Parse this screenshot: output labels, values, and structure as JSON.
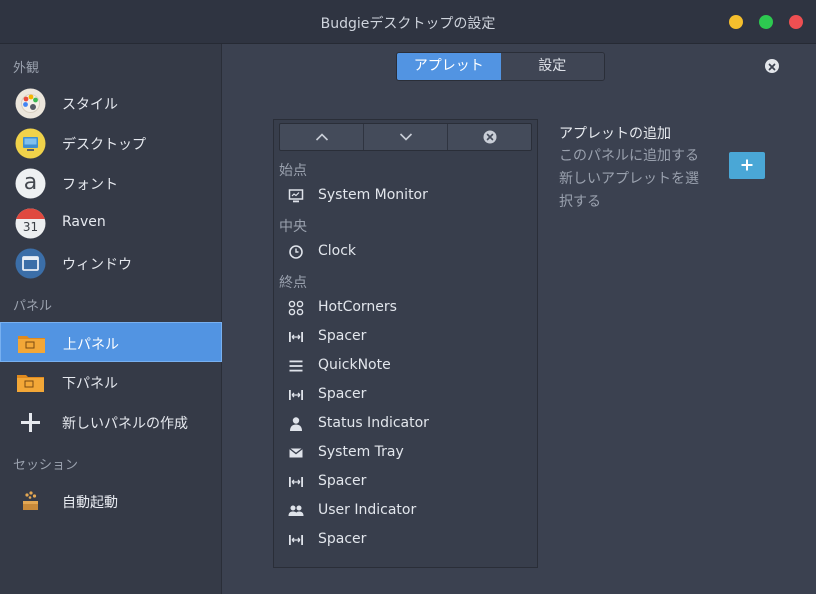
{
  "window": {
    "title": "Budgieデスクトップの設定"
  },
  "sidebar": {
    "sections": [
      {
        "heading": "外観"
      },
      {
        "heading": "パネル"
      },
      {
        "heading": "セッション"
      }
    ],
    "items": [
      {
        "label": "スタイル",
        "icon": "style-palette-icon"
      },
      {
        "label": "デスクトップ",
        "icon": "desktop-icon"
      },
      {
        "label": "フォント",
        "icon": "font-icon"
      },
      {
        "label": "Raven",
        "icon": "calendar-icon"
      },
      {
        "label": "ウィンドウ",
        "icon": "window-icon"
      },
      {
        "label": "上パネル",
        "icon": "folder-icon",
        "selected": true
      },
      {
        "label": "下パネル",
        "icon": "folder-icon"
      },
      {
        "label": "新しいパネルの作成",
        "icon": "plus-icon"
      },
      {
        "label": "自動起動",
        "icon": "autostart-icon"
      }
    ],
    "calendar_day": "31",
    "font_glyph": "a"
  },
  "tabs": [
    {
      "label": "アプレット",
      "active": true
    },
    {
      "label": "設定",
      "active": false
    }
  ],
  "applets": {
    "groups": [
      {
        "label": "始点"
      },
      {
        "label": "中央"
      },
      {
        "label": "終点"
      }
    ],
    "items": [
      {
        "label": "System Monitor",
        "icon": "monitor-icon"
      },
      {
        "label": "Clock",
        "icon": "clock-icon"
      },
      {
        "label": "HotCorners",
        "icon": "hotcorners-icon"
      },
      {
        "label": "Spacer",
        "icon": "spacer-icon"
      },
      {
        "label": "QuickNote",
        "icon": "menu-lines-icon"
      },
      {
        "label": "Spacer",
        "icon": "spacer-icon"
      },
      {
        "label": "Status Indicator",
        "icon": "person-icon"
      },
      {
        "label": "System Tray",
        "icon": "envelope-icon"
      },
      {
        "label": "Spacer",
        "icon": "spacer-icon"
      },
      {
        "label": "User Indicator",
        "icon": "users-icon"
      },
      {
        "label": "Spacer",
        "icon": "spacer-icon"
      }
    ]
  },
  "add_section": {
    "title": "アプレットの追加",
    "description": "このパネルに追加する新しいアプレットを選択する"
  },
  "colors": {
    "accent": "#5294e2",
    "add_button": "#4aa7d6",
    "window_min": "#f5bf2d",
    "window_max": "#2dc950",
    "window_close": "#ee4f52"
  }
}
